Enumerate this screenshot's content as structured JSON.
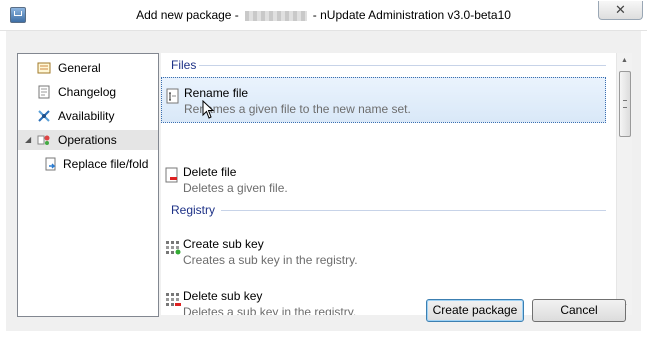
{
  "window": {
    "title_prefix": "Add new package -",
    "title_suffix": "- nUpdate Administration v3.0-beta10",
    "close_glyph": "✕"
  },
  "tree": {
    "items": [
      {
        "label": "General",
        "icon": "general-icon"
      },
      {
        "label": "Changelog",
        "icon": "changelog-icon"
      },
      {
        "label": "Availability",
        "icon": "availability-icon"
      },
      {
        "label": "Operations",
        "icon": "operations-icon",
        "selected": true,
        "expanded": true
      },
      {
        "label": "Replace file/fold",
        "icon": "replace-file-icon"
      }
    ]
  },
  "groups": [
    {
      "name": "Files",
      "items": [
        {
          "title": "Rename file",
          "desc": "Renames a given file to the new name set.",
          "icon": "rename-file-icon"
        },
        {
          "title": "Delete file",
          "desc": "Deletes a given file.",
          "icon": "delete-file-icon"
        }
      ]
    },
    {
      "name": "Registry",
      "items": [
        {
          "title": "Create sub key",
          "desc": "Creates a sub key in the registry.",
          "icon": "create-sub-key-icon"
        },
        {
          "title": "Delete sub key",
          "desc": "Deletes a sub key in the registry.",
          "icon": "delete-sub-key-icon"
        }
      ]
    }
  ],
  "buttons": {
    "create": "Create package",
    "cancel": "Cancel"
  },
  "colors": {
    "accent": "#1e3287",
    "hover_border": "#3b6fb0"
  }
}
